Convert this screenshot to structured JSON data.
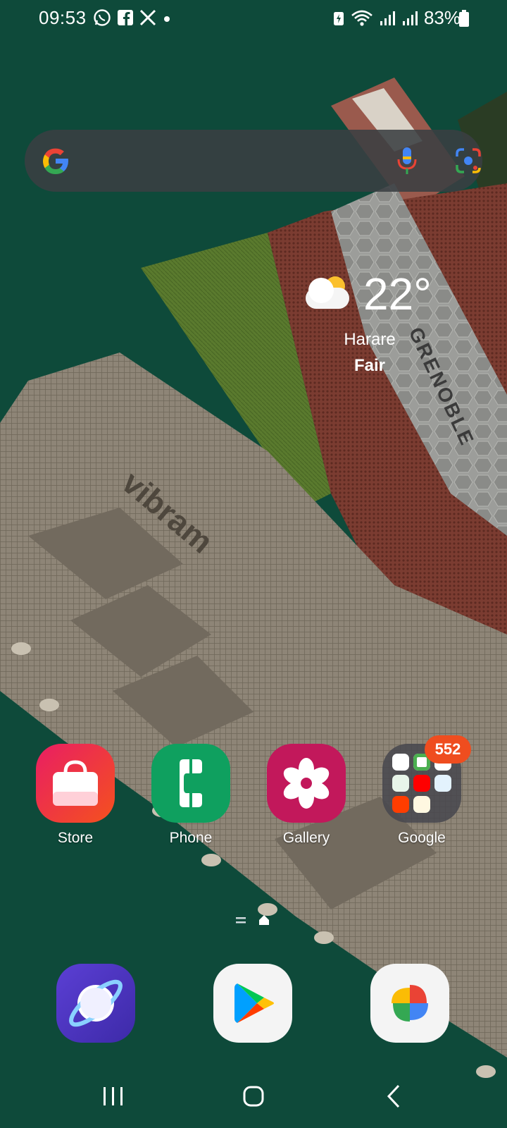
{
  "status_bar": {
    "time": "09:53",
    "battery_percent": "83%",
    "notification_icons": [
      "whatsapp-icon",
      "facebook-icon",
      "x-icon",
      "dot-icon"
    ],
    "system_icons": [
      "battery-saver-icon",
      "wifi-icon",
      "signal-icon",
      "signal-icon"
    ]
  },
  "search": {
    "icons": [
      "google-logo",
      "mic-icon",
      "lens-icon"
    ],
    "colors": {
      "blue": "#4285F4",
      "red": "#EA4335",
      "yellow": "#FBBC05",
      "green": "#34A853"
    }
  },
  "weather": {
    "temperature": "22°",
    "city": "Harare",
    "condition": "Fair"
  },
  "apps": [
    {
      "label": "Store",
      "icon": "store-bag-icon",
      "color": "#e8336b"
    },
    {
      "label": "Phone",
      "icon": "phone-icon",
      "color": "#0f9d58"
    },
    {
      "label": "Gallery",
      "icon": "gallery-flower-icon",
      "color": "#c2185b"
    },
    {
      "label": "Google",
      "icon": "google-folder-icon",
      "badge": "552"
    }
  ],
  "dock": [
    {
      "name": "Samsung Internet",
      "icon": "internet-planet-icon"
    },
    {
      "name": "Play Store",
      "icon": "play-store-icon"
    },
    {
      "name": "Photos",
      "icon": "photos-pinwheel-icon"
    }
  ],
  "nav": [
    "recents-button",
    "home-button",
    "back-button"
  ],
  "wallpaper": {
    "text": "GRENOBLE",
    "logo": "vibram"
  }
}
